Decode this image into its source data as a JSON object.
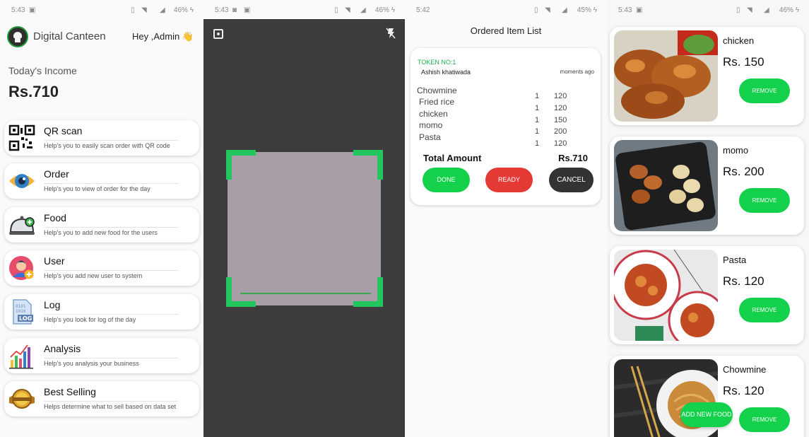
{
  "status": [
    {
      "time": "5:43",
      "battery": "46%"
    },
    {
      "time": "5:43",
      "battery": "46%"
    },
    {
      "time": "5:42",
      "battery": "45%"
    },
    {
      "time": "5:43",
      "battery": "46%"
    }
  ],
  "home": {
    "app_title": "Digital Canteen",
    "greeting": "Hey ,Admin 👋",
    "income_label": "Today's Income",
    "income_value": "Rs.710",
    "menu": [
      {
        "title": "QR scan",
        "desc": "Help's you to easily scan order with QR code",
        "icon": "qr-code-icon"
      },
      {
        "title": "Order",
        "desc": "Help's you to view of order for the day",
        "icon": "eye-icon"
      },
      {
        "title": "Food",
        "desc": "Help's you to add new food for the users",
        "icon": "food-cloche-icon"
      },
      {
        "title": "User",
        "desc": "Help's you add new user to system",
        "icon": "add-user-icon"
      },
      {
        "title": "Log",
        "desc": "Help's you look for log of the day",
        "icon": "log-file-icon"
      },
      {
        "title": "Analysis",
        "desc": "Help's you analysis your business",
        "icon": "bar-chart-icon"
      },
      {
        "title": "Best Selling",
        "desc": "Helps determine what to sell based on data set",
        "icon": "best-seller-badge-icon"
      }
    ]
  },
  "scanner": {
    "icons": [
      "scan-focus-icon",
      "flash-off-icon"
    ]
  },
  "orders": {
    "title": "Ordered Item List",
    "token": "TOKEN NO:1",
    "customer": "Ashish khatiwada",
    "time_ago": "moments ago",
    "items": [
      {
        "name": "Chowmine",
        "qty": "1",
        "price": "120"
      },
      {
        "name": "Fried rice",
        "qty": "1",
        "price": "120"
      },
      {
        "name": "chicken",
        "qty": "1",
        "price": "150"
      },
      {
        "name": "momo",
        "qty": "1",
        "price": "200"
      },
      {
        "name": "Pasta",
        "qty": "1",
        "price": "120"
      }
    ],
    "total_label": "Total Amount",
    "total_value": "Rs.710",
    "buttons": {
      "done": "DONE",
      "ready": "READY",
      "cancel": "CANCEL"
    },
    "colors": {
      "done": "#13d14a",
      "ready": "#e53935",
      "cancel": "#333333",
      "token": "#1fb24a"
    }
  },
  "foods": {
    "items": [
      {
        "name": "chicken",
        "price": "Rs. 150",
        "remove": "REMOVE"
      },
      {
        "name": "momo",
        "price": "Rs. 200",
        "remove": "REMOVE"
      },
      {
        "name": "Pasta",
        "price": "Rs. 120",
        "remove": "REMOVE"
      },
      {
        "name": "Chowmine",
        "price": "Rs. 120",
        "remove": "REMOVE"
      }
    ],
    "add_new": "ADD NEW FOOD",
    "accent": "#13d14a"
  }
}
